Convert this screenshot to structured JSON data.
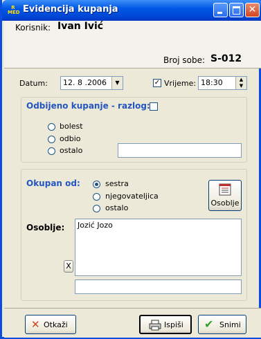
{
  "window": {
    "title": "Evidencija kupanja",
    "icon_text_top": "R",
    "icon_text_bottom": "MED"
  },
  "header": {
    "user_label": "Korisnik:",
    "user_name": "Ivan Ivić",
    "room_label": "Broj sobe:",
    "room_value": "S-012"
  },
  "date_row": {
    "date_label": "Datum:",
    "date_value": "12. 8 .2006",
    "time_checked": true,
    "time_label": "Vrijeme:",
    "time_value": "18:30"
  },
  "refused": {
    "title": "Odbijeno kupanje - razlog:",
    "checked": false,
    "options": [
      "bolest",
      "odbio",
      "ostalo"
    ],
    "other_value": ""
  },
  "bathed": {
    "title": "Okupan od:",
    "options": [
      "sestra",
      "njegovateljica",
      "ostalo"
    ],
    "selected": "sestra",
    "staff_button": "Osoblje"
  },
  "staff": {
    "label": "Osoblje:",
    "value": "Jozić Jozo",
    "clear": "X",
    "extra_value": ""
  },
  "footer": {
    "cancel": "Otkaži",
    "print": "Ispiši",
    "save": "Snimi"
  },
  "colors": {
    "title_blue": "#0058e6",
    "section_title": "#2455c0",
    "cancel_icon": "#d2461f",
    "save_icon": "#2ea42e"
  }
}
